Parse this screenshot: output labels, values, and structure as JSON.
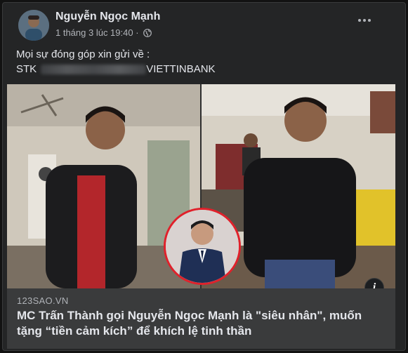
{
  "post": {
    "author": "Nguyễn Ngọc Mạnh",
    "timestamp": "1 tháng 3 lúc 19:40 ·",
    "privacy_icon": "globe-icon",
    "line1": "Mọi sự đóng góp xin gửi về :",
    "line2_prefix": "STK",
    "line2_suffix": "VIETTINBANK"
  },
  "link_preview": {
    "source": "123SAO.VN",
    "title": "MC Trấn Thành gọi Nguyễn Ngọc Mạnh là \"siêu nhân\", muốn tặng “tiền cảm kích” để khích lệ tinh thần"
  },
  "info_icon_label": "i",
  "colors": {
    "background": "#242526",
    "text": "#e4e6eb",
    "secondary_text": "#b0b3b8",
    "link_box": "#3a3b3c",
    "inset_border": "#e0212b"
  }
}
